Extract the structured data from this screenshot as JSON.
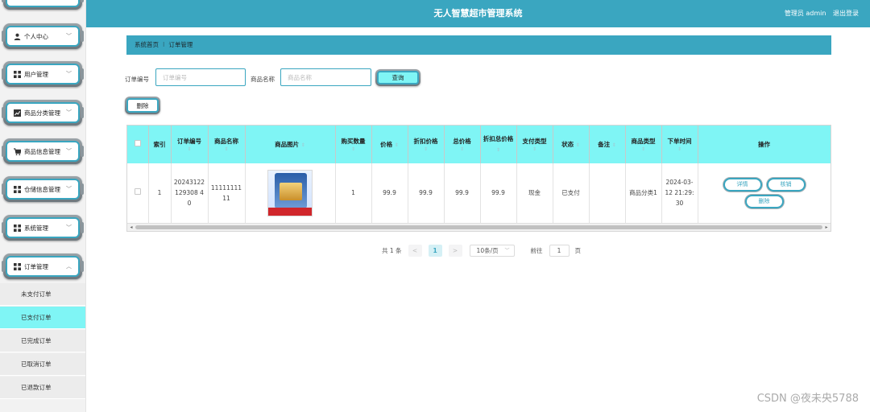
{
  "app": {
    "title": "无人智慧超市管理系统",
    "user_label": "管理员 admin",
    "logout": "退出登录"
  },
  "colors": {
    "accent": "#3aa6c0",
    "highlight": "#7ff5f5"
  },
  "sidebar": {
    "menus": [
      {
        "label": "个人中心",
        "icon": "person-icon"
      },
      {
        "label": "用户管理",
        "icon": "grid-icon"
      },
      {
        "label": "商品分类管理",
        "icon": "chart-icon"
      },
      {
        "label": "商品信息管理",
        "icon": "cart-icon"
      },
      {
        "label": "仓储信息管理",
        "icon": "grid-icon"
      },
      {
        "label": "系统管理",
        "icon": "grid-icon"
      },
      {
        "label": "订单管理",
        "icon": "grid-icon",
        "expanded": true
      }
    ],
    "submenu": [
      {
        "label": "未支付订单"
      },
      {
        "label": "已支付订单",
        "active": true
      },
      {
        "label": "已完成订单"
      },
      {
        "label": "已取消订单"
      },
      {
        "label": "已退款订单"
      }
    ]
  },
  "breadcrumb": {
    "home": "系统首页",
    "current": "订单管理"
  },
  "search": {
    "order_no_label": "订单编号",
    "order_no_placeholder": "订单编号",
    "order_no_value": "",
    "product_name_label": "商品名称",
    "product_name_placeholder": "商品名称",
    "product_name_value": "",
    "query_button": "查询",
    "delete_button": "删除"
  },
  "table": {
    "headers": [
      "索引",
      "订单编号",
      "商品名称",
      "商品图片",
      "购买数量",
      "价格",
      "折扣价格",
      "总价格",
      "折扣总价格",
      "支付类型",
      "状态",
      "备注",
      "商品类型",
      "下单时间",
      "操作"
    ],
    "rows": [
      {
        "index": "1",
        "order_no": "20243122129308 40",
        "product_name": "1111111111",
        "quantity": "1",
        "price": "99.9",
        "discount_price": "99.9",
        "total_price": "99.9",
        "discount_total": "99.9",
        "pay_type": "现金",
        "status": "已支付",
        "remark": "",
        "product_type": "商品分类1",
        "order_time": "2024-03-12 21:29:30",
        "actions": [
          "详情",
          "核销",
          "删除"
        ]
      }
    ]
  },
  "pagination": {
    "total": "共 1 条",
    "prev": "<",
    "current_page": "1",
    "next": ">",
    "page_size": "10条/页",
    "goto_label": "前往",
    "goto_value": "1",
    "page_unit": "页"
  },
  "watermark": "CSDN @夜未央5788"
}
